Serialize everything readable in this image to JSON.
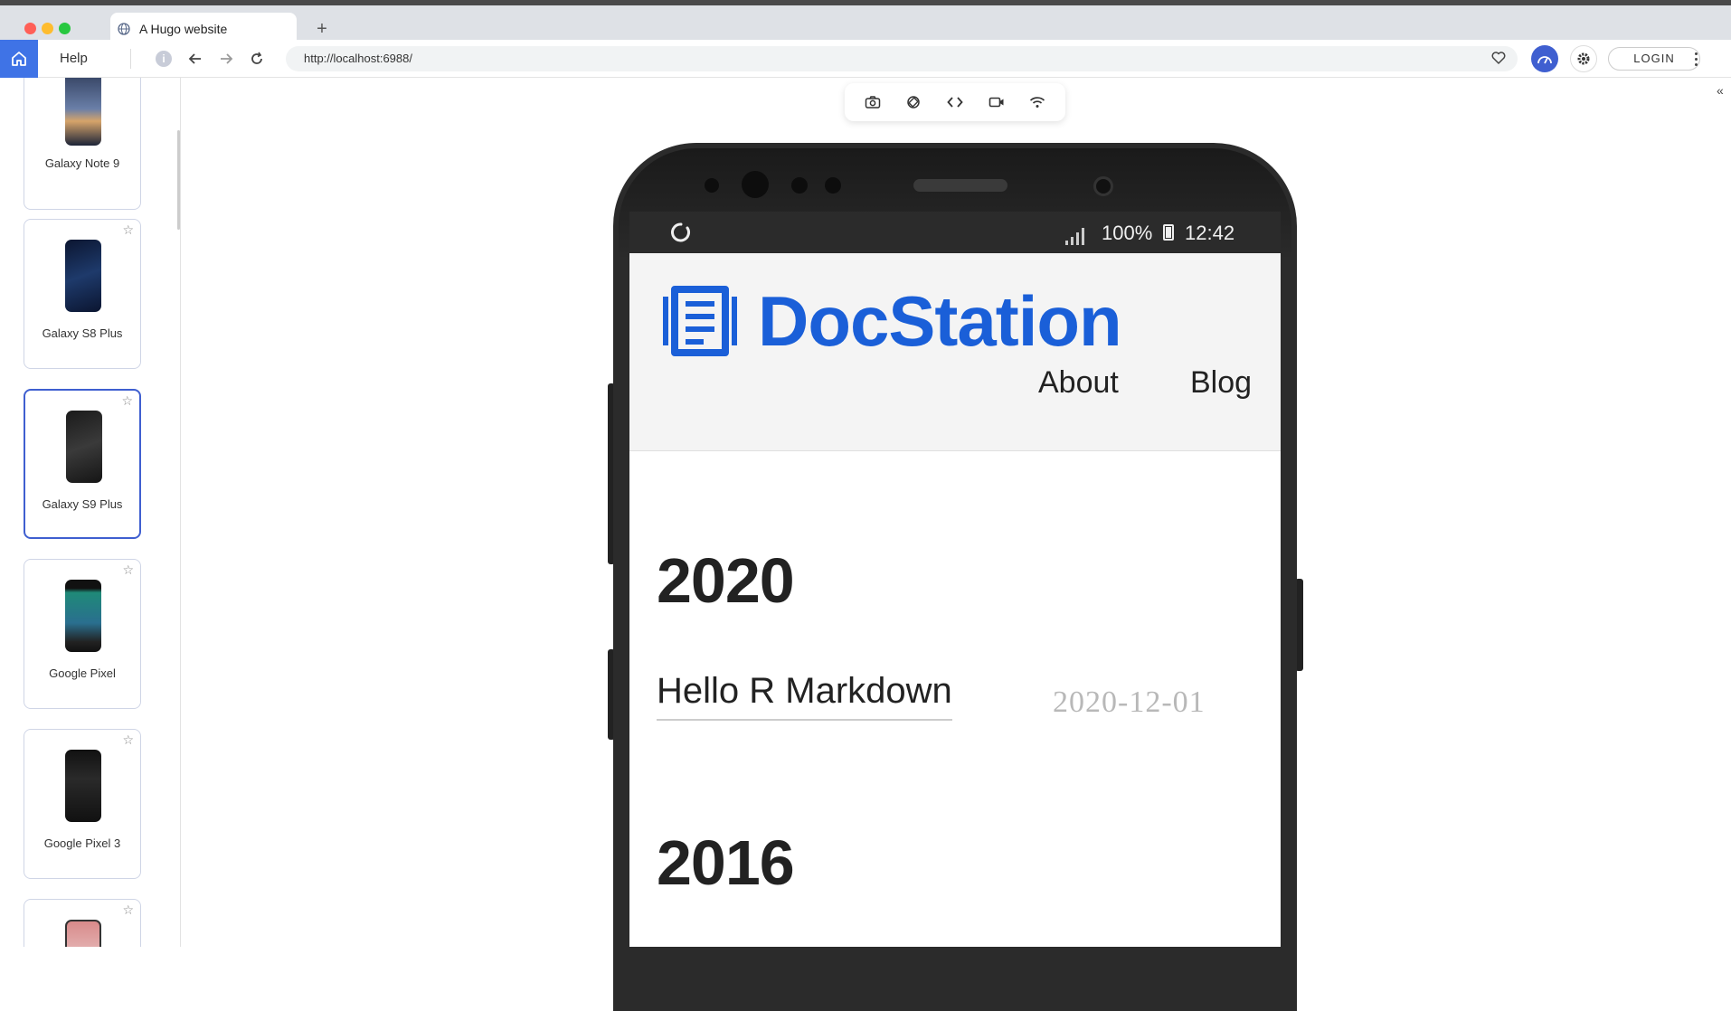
{
  "browser": {
    "tab_title": "A Hugo website",
    "new_tab_symbol": "+",
    "help_label": "Help",
    "url": "http://localhost:6988/",
    "login_label": "LOGIN",
    "info_symbol": "i",
    "collapse_symbol": "«"
  },
  "sidebar": {
    "devices": [
      {
        "name": "Galaxy Note 9",
        "selected": false
      },
      {
        "name": "Galaxy S8 Plus",
        "selected": false
      },
      {
        "name": "Galaxy S9 Plus",
        "selected": true
      },
      {
        "name": "Google Pixel",
        "selected": false
      },
      {
        "name": "Google Pixel 3",
        "selected": false
      },
      {
        "name": "",
        "selected": false
      }
    ],
    "star_symbol": "☆"
  },
  "devtools": {
    "tools": [
      "screenshot-icon",
      "rotate-icon",
      "code-icon",
      "video-icon",
      "wifi-icon"
    ]
  },
  "phone": {
    "battery_pct": "100%",
    "time": "12:42"
  },
  "site": {
    "brand": "DocStation",
    "brand_color": "#1a5fd8",
    "nav": {
      "about": "About",
      "blog": "Blog"
    },
    "year_1": "2020",
    "post_title": "Hello R Markdown",
    "post_date": "2020-12-01",
    "year_2": "2016"
  },
  "colors": {
    "accent": "#3f5fd0",
    "home_button": "#3f73e6"
  }
}
